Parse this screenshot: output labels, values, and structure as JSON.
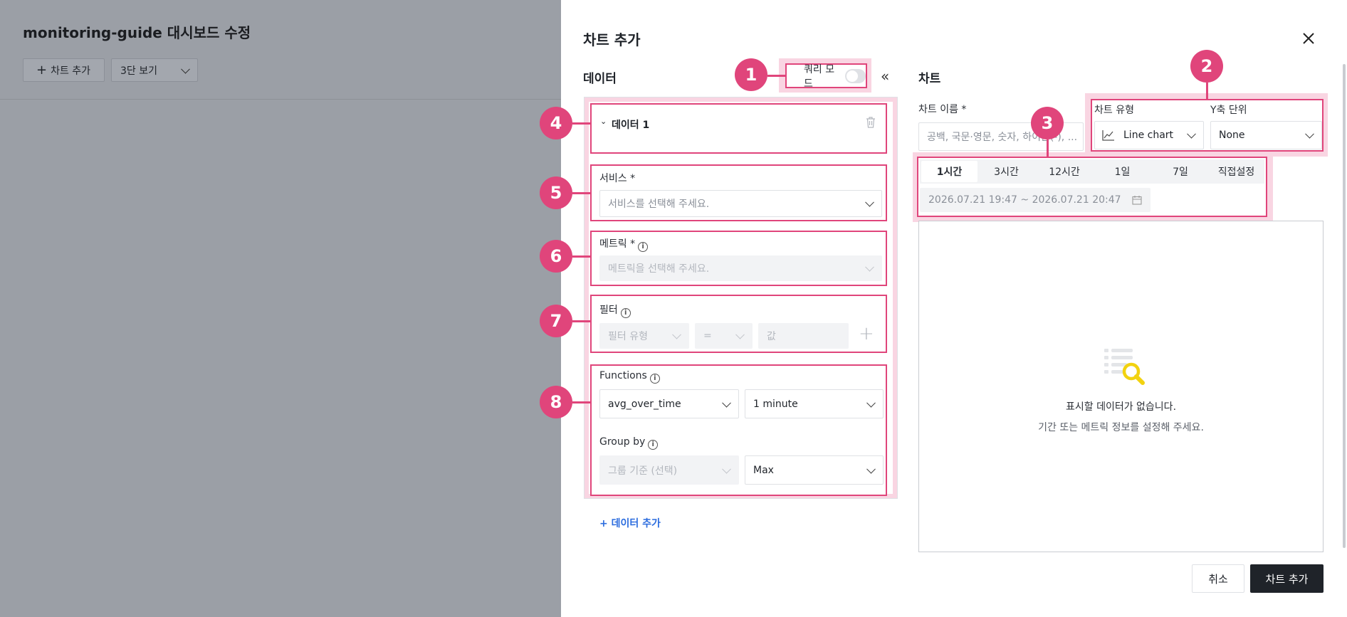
{
  "background": {
    "title": "monitoring-guide 대시보드 수정",
    "add_chart_label": "차트 추가",
    "view_select": "3단 보기"
  },
  "drawer": {
    "title": "차트 추가",
    "data_section": "데이터",
    "query_mode_label": "쿼리 모드",
    "query_mode_on": false,
    "chart_section": "차트",
    "data_block": {
      "title": "데이터 1",
      "service_label": "서비스 *",
      "service_placeholder": "서비스를 선택해 주세요.",
      "metric_label": "메트릭 *",
      "metric_placeholder": "메트릭을 선택해 주세요.",
      "filter_label": "필터",
      "filter_type_placeholder": "필터 유형",
      "filter_operator": "=",
      "filter_value_placeholder": "값",
      "functions_label": "Functions",
      "function_value": "avg_over_time",
      "interval_value": "1 minute",
      "groupby_label": "Group by",
      "groupby_placeholder": "그룹 기준 (선택)",
      "aggregate_value": "Max"
    },
    "add_data_label": "+ 데이터 추가",
    "chart_name_label": "차트 이름 *",
    "chart_name_placeholder": "공백, 국문·영문, 숫자, 하이픈(-), ...",
    "chart_type_label": "차트 유형",
    "chart_type_value": "Line chart",
    "y_unit_label": "Y축 단위",
    "y_unit_value": "None",
    "time_tabs": [
      "1시간",
      "3시간",
      "12시간",
      "1일",
      "7일",
      "직접설정"
    ],
    "active_tab": "1시간",
    "date_range": "2026.07.21 19:47 ~ 2026.07.21 20:47",
    "empty_title": "표시할 데이터가 없습니다.",
    "empty_desc": "기간 또는 메트릭 정보를 설정해 주세요.",
    "cancel_label": "취소",
    "submit_label": "차트 추가"
  },
  "annotations": [
    "1",
    "2",
    "3",
    "4",
    "5",
    "6",
    "7",
    "8"
  ],
  "colors": {
    "highlight": "#e0457b",
    "highlight_fill": "#f9d5e2",
    "primary_button": "#1f2329",
    "overlay": "#9b9fa6"
  }
}
